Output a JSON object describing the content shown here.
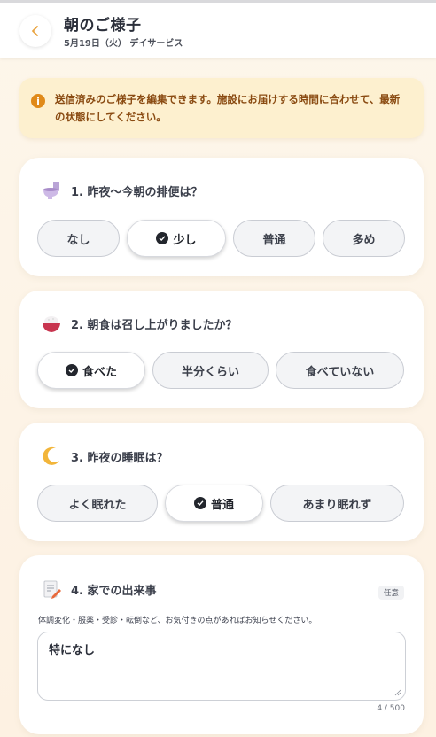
{
  "header": {
    "title": "朝のご様子",
    "subtitle": "5月19日（火） デイサービス",
    "back_icon": "chevron-left-icon",
    "accent": "#e9a440"
  },
  "notice": {
    "icon": "info-icon",
    "icon_glyph": "i",
    "text": "送信済みのご様子を編集できます。施設にお届けする時間に合わせて、最新の状態にしてください。"
  },
  "questions": [
    {
      "icon": "toilet-icon",
      "title": "1. 昨夜〜今朝の排便は？",
      "options": [
        "なし",
        "少し",
        "普通",
        "多め"
      ],
      "selected": "少し"
    },
    {
      "icon": "rice-bowl-icon",
      "title": "2. 朝食は召し上がりましたか？",
      "options": [
        "食べた",
        "半分くらい",
        "食べていない"
      ],
      "selected": "食べた"
    },
    {
      "icon": "moon-icon",
      "title": "3. 昨夜の睡眠は？",
      "options": [
        "よく眠れた",
        "普通",
        "あまり眠れず"
      ],
      "selected": "普通"
    }
  ],
  "notes": {
    "icon": "memo-icon",
    "title": "4. 家での出来事",
    "badge": "任意",
    "hint": "体調変化・服薬・受診・転倒など、お気付きの点があればお知らせください。",
    "value": "特になし",
    "counter": "4 / 500"
  }
}
